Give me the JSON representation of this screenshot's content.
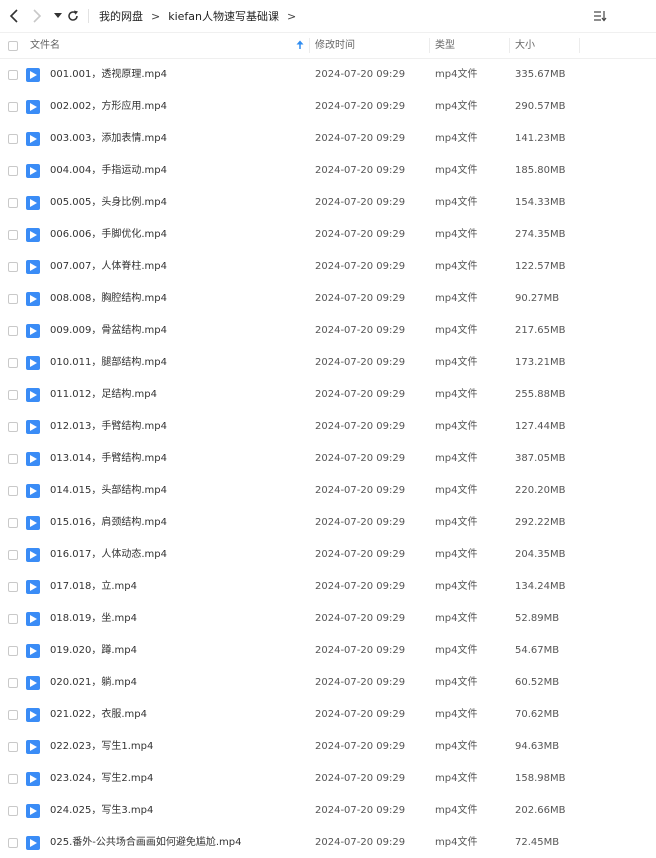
{
  "toolbar": {
    "breadcrumb": [
      "我的网盘",
      "kiefan人物速写基础课"
    ]
  },
  "columns": {
    "name": "文件名",
    "time": "修改时间",
    "type": "类型",
    "size": "大小"
  },
  "colors": {
    "accent": "#3a8cf6",
    "sort_arrow": "#2f8cf0"
  },
  "files": [
    {
      "name": "001.001，透视原理.mp4",
      "time": "2024-07-20 09:29",
      "type": "mp4文件",
      "size": "335.67MB"
    },
    {
      "name": "002.002，方形应用.mp4",
      "time": "2024-07-20 09:29",
      "type": "mp4文件",
      "size": "290.57MB"
    },
    {
      "name": "003.003，添加表情.mp4",
      "time": "2024-07-20 09:29",
      "type": "mp4文件",
      "size": "141.23MB"
    },
    {
      "name": "004.004，手指运动.mp4",
      "time": "2024-07-20 09:29",
      "type": "mp4文件",
      "size": "185.80MB"
    },
    {
      "name": "005.005，头身比例.mp4",
      "time": "2024-07-20 09:29",
      "type": "mp4文件",
      "size": "154.33MB"
    },
    {
      "name": "006.006，手脚优化.mp4",
      "time": "2024-07-20 09:29",
      "type": "mp4文件",
      "size": "274.35MB"
    },
    {
      "name": "007.007，人体脊柱.mp4",
      "time": "2024-07-20 09:29",
      "type": "mp4文件",
      "size": "122.57MB"
    },
    {
      "name": "008.008，胸腔结构.mp4",
      "time": "2024-07-20 09:29",
      "type": "mp4文件",
      "size": "90.27MB"
    },
    {
      "name": "009.009，骨盆结构.mp4",
      "time": "2024-07-20 09:29",
      "type": "mp4文件",
      "size": "217.65MB"
    },
    {
      "name": "010.011，腿部结构.mp4",
      "time": "2024-07-20 09:29",
      "type": "mp4文件",
      "size": "173.21MB"
    },
    {
      "name": "011.012，足结构.mp4",
      "time": "2024-07-20 09:29",
      "type": "mp4文件",
      "size": "255.88MB"
    },
    {
      "name": "012.013，手臂结构.mp4",
      "time": "2024-07-20 09:29",
      "type": "mp4文件",
      "size": "127.44MB"
    },
    {
      "name": "013.014，手臂结构.mp4",
      "time": "2024-07-20 09:29",
      "type": "mp4文件",
      "size": "387.05MB"
    },
    {
      "name": "014.015，头部结构.mp4",
      "time": "2024-07-20 09:29",
      "type": "mp4文件",
      "size": "220.20MB"
    },
    {
      "name": "015.016，肩颈结构.mp4",
      "time": "2024-07-20 09:29",
      "type": "mp4文件",
      "size": "292.22MB"
    },
    {
      "name": "016.017，人体动态.mp4",
      "time": "2024-07-20 09:29",
      "type": "mp4文件",
      "size": "204.35MB"
    },
    {
      "name": "017.018，立.mp4",
      "time": "2024-07-20 09:29",
      "type": "mp4文件",
      "size": "134.24MB"
    },
    {
      "name": "018.019，坐.mp4",
      "time": "2024-07-20 09:29",
      "type": "mp4文件",
      "size": "52.89MB"
    },
    {
      "name": "019.020，蹲.mp4",
      "time": "2024-07-20 09:29",
      "type": "mp4文件",
      "size": "54.67MB"
    },
    {
      "name": "020.021，躺.mp4",
      "time": "2024-07-20 09:29",
      "type": "mp4文件",
      "size": "60.52MB"
    },
    {
      "name": "021.022，衣服.mp4",
      "time": "2024-07-20 09:29",
      "type": "mp4文件",
      "size": "70.62MB"
    },
    {
      "name": "022.023，写生1.mp4",
      "time": "2024-07-20 09:29",
      "type": "mp4文件",
      "size": "94.63MB"
    },
    {
      "name": "023.024，写生2.mp4",
      "time": "2024-07-20 09:29",
      "type": "mp4文件",
      "size": "158.98MB"
    },
    {
      "name": "024.025，写生3.mp4",
      "time": "2024-07-20 09:29",
      "type": "mp4文件",
      "size": "202.66MB"
    },
    {
      "name": "025.番外-公共场合画画如何避免尴尬.mp4",
      "time": "2024-07-20 09:29",
      "type": "mp4文件",
      "size": "72.45MB"
    }
  ]
}
